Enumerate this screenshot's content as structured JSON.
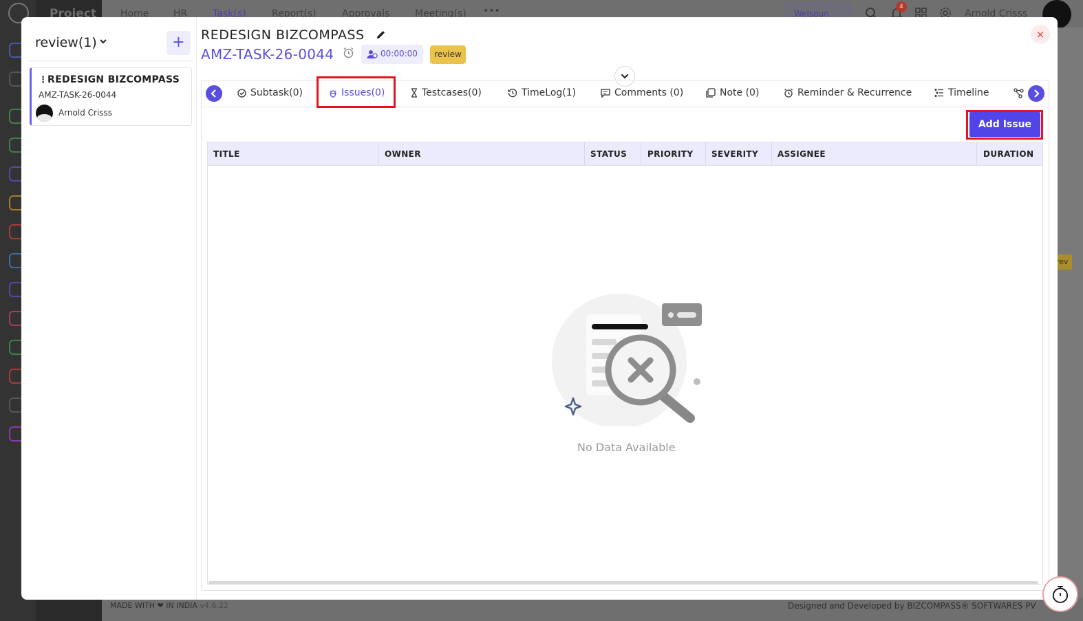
{
  "background": {
    "app_name": "Project",
    "nav": [
      "Home",
      "HR",
      "Task(s)",
      "Report(s)",
      "Approvals",
      "Meeting(s)",
      "•••"
    ],
    "org_selector": "Welspun",
    "notification_count": "4",
    "user_name": "Arnold Crisss",
    "side_badge": "rev",
    "footer_left": "MADE WITH ❤ IN INDIA",
    "footer_version": "v4.6.22",
    "footer_right": "Designed and Developed by  BIZCOMPASS® SOFTWARES PV"
  },
  "left_panel": {
    "title": "review(1)",
    "add_label": "+",
    "task_card": {
      "title": "REDESIGN BIZCOMPASS",
      "code": "AMZ-TASK-26-0044",
      "owner": "Arnold Crisss"
    }
  },
  "header": {
    "title": "REDESIGN BIZCOMPASS",
    "code": "AMZ-TASK-26-0044",
    "timer": "00:00:00",
    "status": "review",
    "close_label": "×"
  },
  "tabs": [
    {
      "label": "Subtask(0)",
      "icon": "check-circle-icon"
    },
    {
      "label": "Issues(0)",
      "icon": "bug-icon"
    },
    {
      "label": "Testcases(0)",
      "icon": "hourglass-icon"
    },
    {
      "label": "TimeLog(1)",
      "icon": "history-icon"
    },
    {
      "label": "Comments (0)",
      "icon": "comment-icon"
    },
    {
      "label": "Note (0)",
      "icon": "note-icon"
    },
    {
      "label": "Reminder & Recurrence",
      "icon": "alarm-icon"
    },
    {
      "label": "Timeline",
      "icon": "timeline-icon"
    }
  ],
  "active_tab": "Issues(0)",
  "actions": {
    "add_issue": "Add Issue"
  },
  "table": {
    "columns": [
      "TITLE",
      "OWNER",
      "STATUS",
      "PRIORITY",
      "SEVERITY",
      "ASSIGNEE",
      "DURATION"
    ],
    "rows": [],
    "empty_text": "No Data Available"
  },
  "colors": {
    "accent": "#5a4ee0",
    "highlight": "#e3131f",
    "badge_yellow": "#ecc34a",
    "table_header": "#ecebfd"
  }
}
